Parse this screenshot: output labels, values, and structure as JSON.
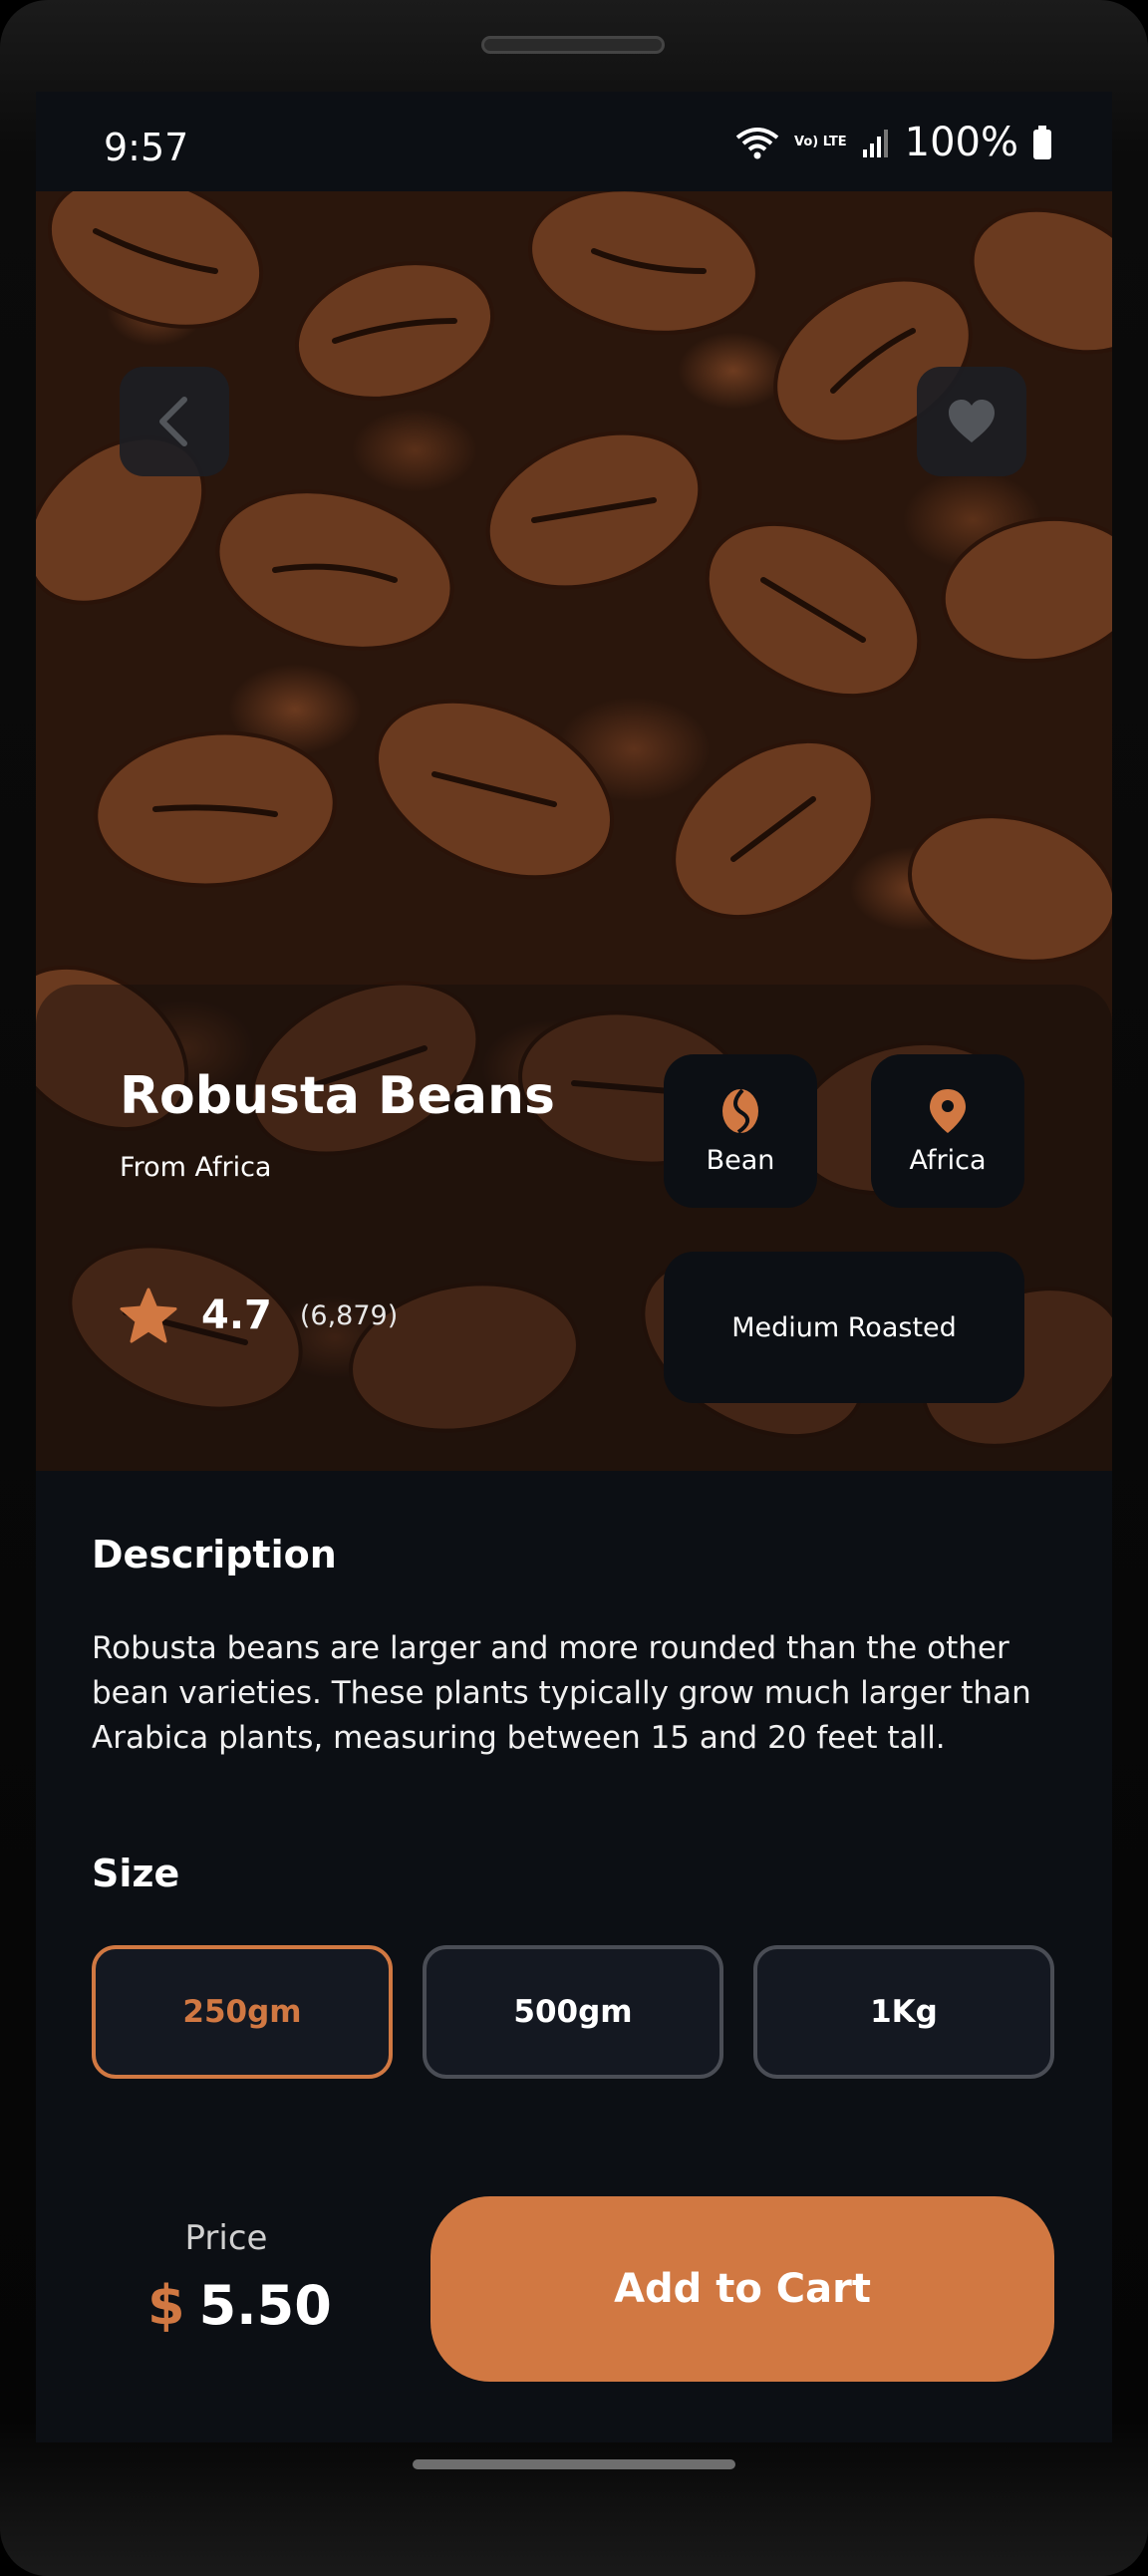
{
  "status_bar": {
    "time": "9:57",
    "network": "Vo) LTE",
    "battery": "100%"
  },
  "hero": {
    "back_icon": "chevron-left-icon",
    "favorite_icon": "heart-icon"
  },
  "product": {
    "name": "Robusta Beans",
    "origin": "From Africa",
    "rating": "4.7",
    "rating_count": "(6,879)",
    "type_label": "Bean",
    "region_label": "Africa",
    "roast": "Medium Roasted"
  },
  "description": {
    "heading": "Description",
    "text": "Robusta beans are larger and more rounded than the other bean varieties. These plants typically grow much larger than Arabica plants, measuring between 15 and 20 feet tall."
  },
  "size": {
    "heading": "Size",
    "options": [
      "250gm",
      "500gm",
      "1Kg"
    ],
    "selected": "250gm"
  },
  "purchase": {
    "price_label": "Price",
    "currency": "$",
    "price": "5.50",
    "cart_label": "Add to Cart"
  },
  "colors": {
    "accent": "#d17842",
    "background": "#0c0f14",
    "tile": "#0c0f14",
    "size_border": "#4a4d55"
  }
}
